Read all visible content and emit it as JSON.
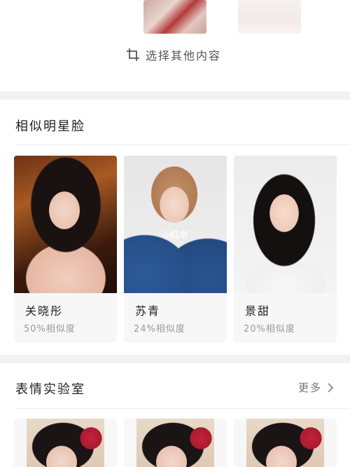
{
  "top": {
    "select_other_label": "选择其他内容"
  },
  "similar": {
    "title": "相似明星脸",
    "cards": [
      {
        "name": "关晓彤",
        "similarity": "50%相似度"
      },
      {
        "name": "苏青",
        "similarity": "24%相似度"
      },
      {
        "name": "景甜",
        "similarity": "20%相似度"
      }
    ],
    "watermark": "小红书"
  },
  "lab": {
    "title": "表情实验室",
    "more_label": "更多"
  },
  "icons": {
    "crop": "crop-icon",
    "more": "chevron-right-icon"
  },
  "colors": {
    "divider_band": "#f2f2f2",
    "card_bg": "#f7f7f7",
    "muted_text": "#999999"
  }
}
